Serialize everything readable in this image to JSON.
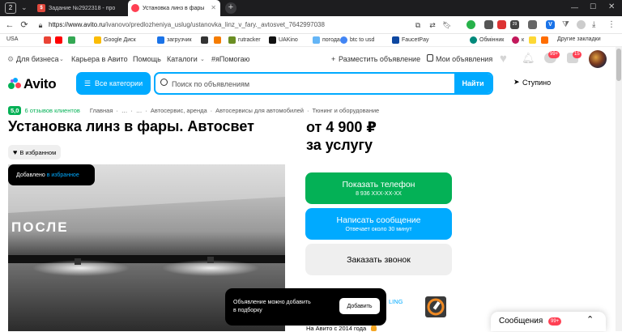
{
  "browser": {
    "tab_counter": "2",
    "tabs": [
      {
        "label": "Задание №2922318 - про",
        "favicon": "sp-icon"
      },
      {
        "label": "Установка линз в фары",
        "favicon": "avito-icon",
        "active": true
      }
    ],
    "url_host": "https://www.avito.ru",
    "url_path": "/ivanovo/predlozheniya_uslug/ustanovka_linz_v_fary._avtosvet_7642997038",
    "bookmarks": [
      "USA",
      "Google Диск",
      "загрузчик",
      "rutracker",
      "UAKino",
      "погода",
      "btc to usd",
      "FaucetPay",
      "Обмінник",
      "к"
    ],
    "other_bookmarks": "Другие закладки",
    "ext_badge": "29"
  },
  "topnav": {
    "items": [
      "Для бизнеса",
      "Карьера в Авито",
      "Помощь",
      "Каталоги",
      "#яПомогаю"
    ],
    "post_ad": "Разместить объявление",
    "my_ads": "Мои объявления",
    "notif_badge": "99+",
    "cart_badge": "15"
  },
  "header": {
    "logo": "Avito",
    "categories_btn": "Все категории",
    "search_placeholder": "Поиск по объявлениям",
    "search_btn": "Найти",
    "location": "Ступино"
  },
  "breadcrumbs": {
    "rating": "5,0",
    "reviews": "6 отзывов клиентов",
    "items": [
      "Главная",
      "…",
      "…",
      "Автосервис, аренда",
      "Автосервисы для автомобилей",
      "Тюнинг и оборудование"
    ]
  },
  "listing": {
    "title": "Установка линз в фары. Автосвет",
    "price_line1": "от 4 900 ₽",
    "price_line2": "за услугу",
    "favorites_btn": "В избранном",
    "photo_caption": "ПОСЛЕ",
    "toast_added_prefix": "Добавлено ",
    "toast_added_link": "в избранное"
  },
  "actions": {
    "phone_btn": "Показать телефон",
    "phone_number": "8 936 XXX-XX-XX",
    "message_btn": "Написать сообщение",
    "message_sub": "Отвечает около 30 минут",
    "call_btn": "Заказать звонок"
  },
  "seller": {
    "name_fragment": "LING",
    "since": "На Авито с 2014 года"
  },
  "toast": {
    "text_line1": "Объявление можно добавить",
    "text_line2": "в подборку",
    "add_btn": "Добавить"
  },
  "messages": {
    "label": "Сообщения",
    "badge": "99+"
  },
  "colors": {
    "brand_blue": "#00aaff",
    "cta_green": "#04b156",
    "badge_red": "#ff4053"
  }
}
